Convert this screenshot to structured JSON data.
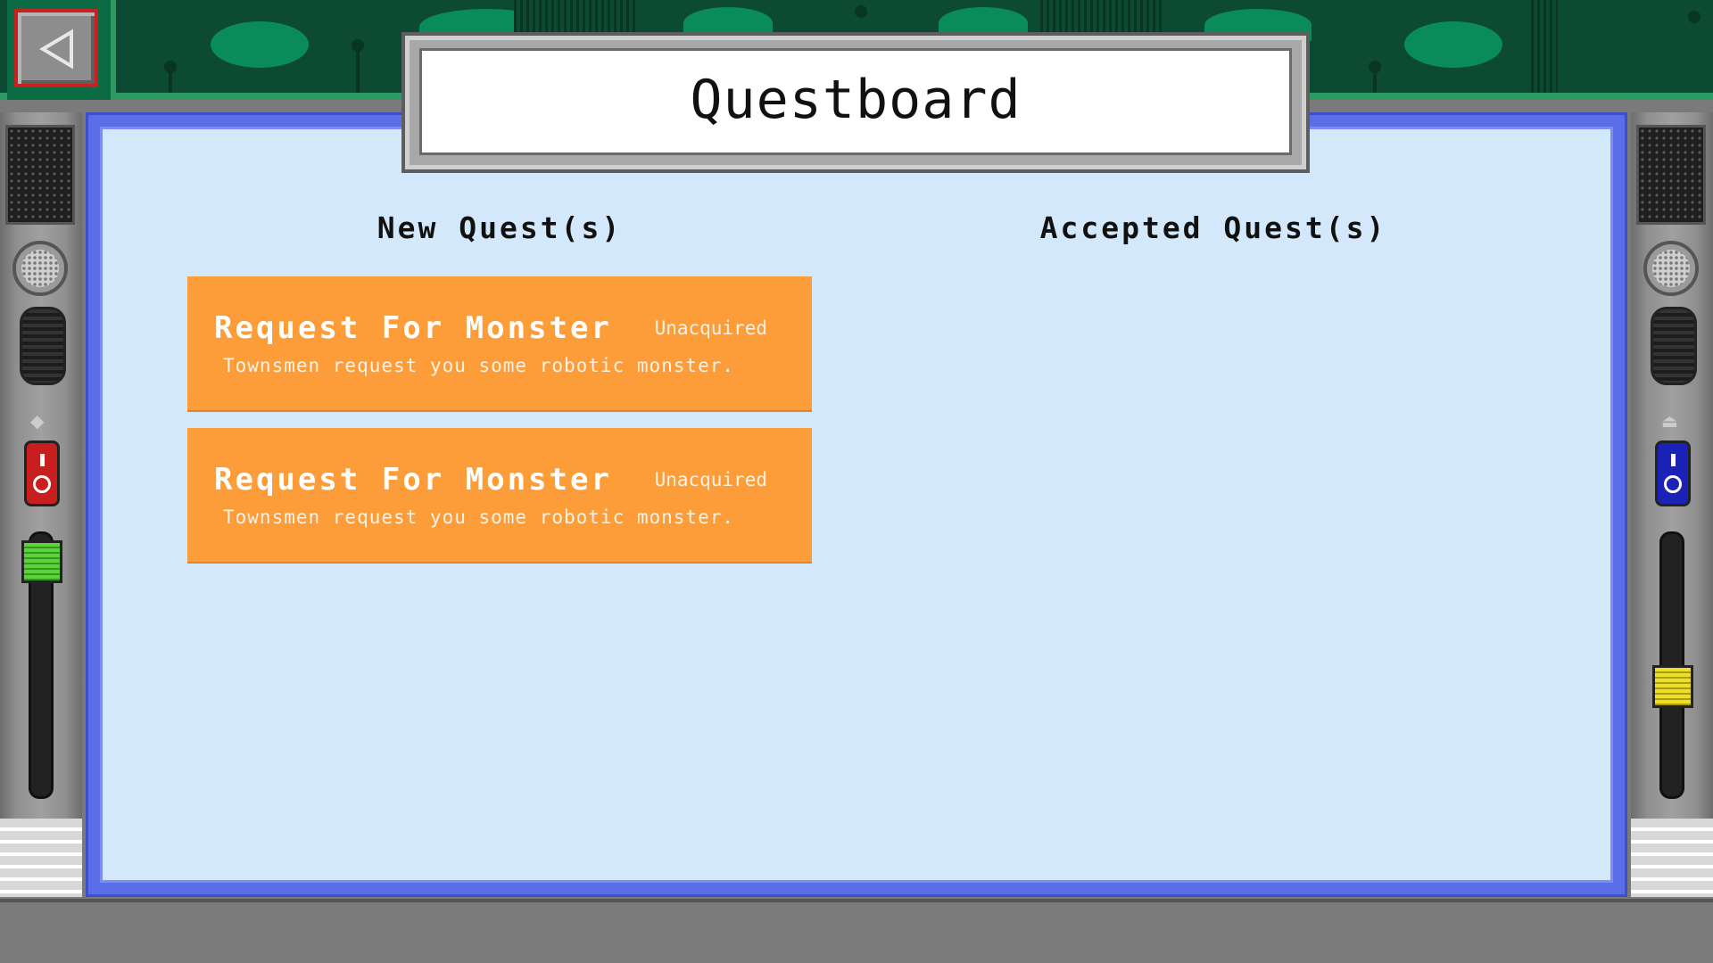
{
  "header": {
    "back_icon": "triangle-left-icon",
    "title": "Questboard"
  },
  "columns": {
    "new_heading": "New Quest(s)",
    "accepted_heading": "Accepted Quest(s)"
  },
  "new_quests": [
    {
      "title": "Request For Monster",
      "status": "Unacquired",
      "description": "Townsmen request you some robotic monster."
    },
    {
      "title": "Request For Monster",
      "status": "Unacquired",
      "description": "Townsmen request you some robotic monster."
    }
  ],
  "accepted_quests": [],
  "side_panels": {
    "left": {
      "switch_color": "#c81e1e",
      "slider_color": "green",
      "slider_level": 1.0
    },
    "right": {
      "switch_color": "#1a22b8",
      "slider_color": "yellow",
      "slider_level": 0.45
    }
  },
  "colors": {
    "board_background": "#d3e9fb",
    "board_border": "#5a6ee8",
    "quest_card": "#fd9d39",
    "circuit_green": "#0c4a33"
  }
}
